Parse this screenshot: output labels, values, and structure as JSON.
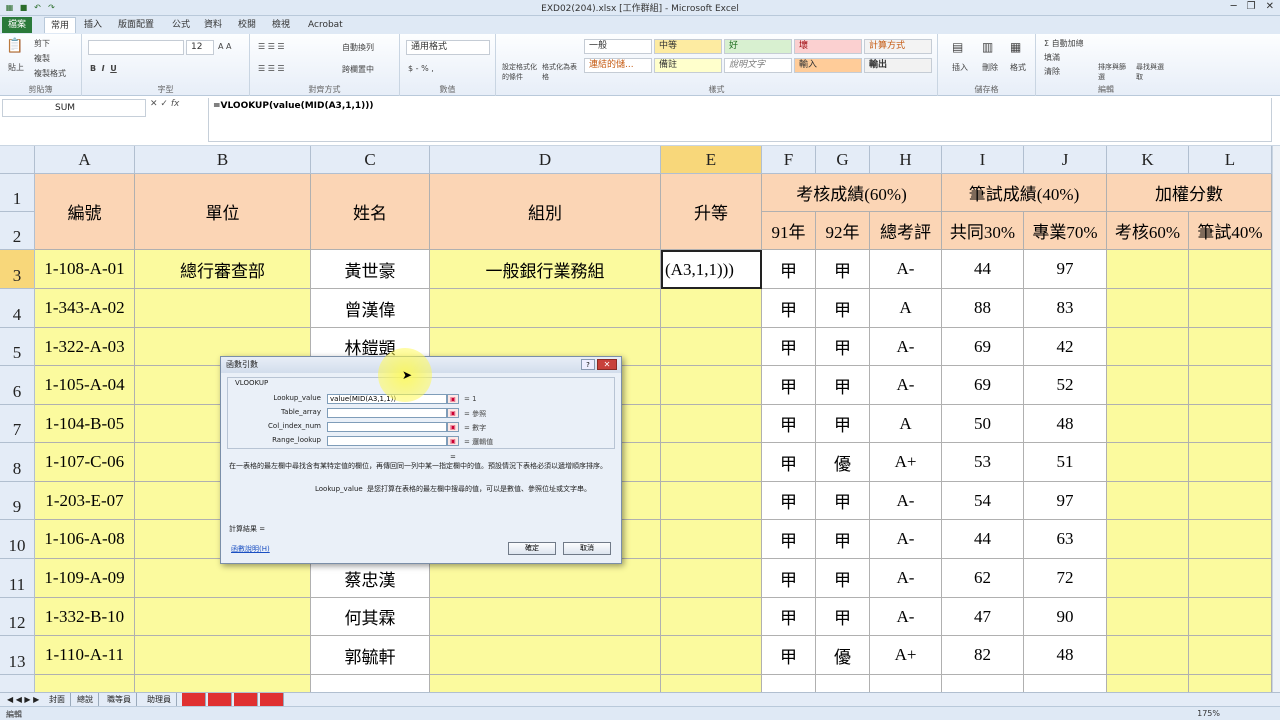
{
  "window": {
    "title": "EXD02(204).xlsx [工作群組] - Microsoft Excel"
  },
  "ribbon_tabs": [
    "檔案",
    "常用",
    "插入",
    "版面配置",
    "公式",
    "資料",
    "校閱",
    "檢視",
    "Acrobat"
  ],
  "ribbon": {
    "clipboard": {
      "label": "剪貼簿",
      "paste": "貼上",
      "cut": "剪下",
      "copy": "複製",
      "format_painter": "複製格式"
    },
    "font": {
      "label": "字型",
      "size": "12"
    },
    "alignment": {
      "label": "對齊方式",
      "wrap": "自動換列",
      "merge": "跨欄置中"
    },
    "number": {
      "label": "數值",
      "format": "通用格式"
    },
    "styles": {
      "label": "樣式",
      "conditional": "設定格式化的條件",
      "as_table": "格式化為表格",
      "items": [
        "一般",
        "中等",
        "好",
        "壞",
        "計算方式",
        "連結的儲...",
        "備註",
        "說明文字",
        "輸入",
        "輸出"
      ]
    },
    "cells": {
      "label": "儲存格",
      "insert": "插入",
      "delete": "刪除",
      "format": "格式"
    },
    "editing": {
      "label": "編輯",
      "autosum": "自動加總",
      "fill": "填滿",
      "clear": "清除",
      "sort": "排序與篩選",
      "find": "尋找與選取"
    }
  },
  "formula_bar": {
    "name_box": "SUM",
    "formula": "=VLOOKUP(value(MID(A3,1,1)))"
  },
  "columns": [
    "A",
    "B",
    "C",
    "D",
    "E",
    "F",
    "G",
    "H",
    "I",
    "J",
    "K",
    "L"
  ],
  "row_numbers": [
    "1",
    "2",
    "3",
    "4",
    "5",
    "6",
    "7",
    "8",
    "9",
    "10",
    "11",
    "12",
    "13"
  ],
  "headers": {
    "id": "編號",
    "unit": "單位",
    "name": "姓名",
    "group": "組別",
    "promotion": "升等",
    "assessment": "考核成績(60%)",
    "written": "筆試成績(40%)",
    "weighted": "加權分數",
    "y91": "91年",
    "y92": "92年",
    "total": "總考評",
    "common": "共同30%",
    "special": "專業70%",
    "assess60": "考核60%",
    "written40": "筆試40%"
  },
  "rows": [
    {
      "id": "1-108-A-01",
      "unit": "總行審查部",
      "name": "黃世豪",
      "group": "一般銀行業務組",
      "promo": "(A3,1,1)))",
      "f": "甲",
      "g": "甲",
      "h": "A-",
      "i": "44",
      "j": "97"
    },
    {
      "id": "1-343-A-02",
      "unit": "",
      "name": "曾漢偉",
      "group": "",
      "promo": "",
      "f": "甲",
      "g": "甲",
      "h": "A",
      "i": "88",
      "j": "83"
    },
    {
      "id": "1-322-A-03",
      "unit": "",
      "name": "林鎧顗",
      "group": "",
      "promo": "",
      "f": "甲",
      "g": "甲",
      "h": "A-",
      "i": "69",
      "j": "42"
    },
    {
      "id": "1-105-A-04",
      "unit": "",
      "name": "",
      "group": "",
      "promo": "",
      "f": "甲",
      "g": "甲",
      "h": "A-",
      "i": "69",
      "j": "52"
    },
    {
      "id": "1-104-B-05",
      "unit": "",
      "name": "",
      "group": "",
      "promo": "",
      "f": "甲",
      "g": "甲",
      "h": "A",
      "i": "50",
      "j": "48"
    },
    {
      "id": "1-107-C-06",
      "unit": "",
      "name": "",
      "group": "",
      "promo": "",
      "f": "甲",
      "g": "優",
      "h": "A+",
      "i": "53",
      "j": "51"
    },
    {
      "id": "1-203-E-07",
      "unit": "",
      "name": "",
      "group": "",
      "promo": "",
      "f": "甲",
      "g": "甲",
      "h": "A-",
      "i": "54",
      "j": "97"
    },
    {
      "id": "1-106-A-08",
      "unit": "",
      "name": "",
      "group": "",
      "promo": "",
      "f": "甲",
      "g": "甲",
      "h": "A-",
      "i": "44",
      "j": "63"
    },
    {
      "id": "1-109-A-09",
      "unit": "",
      "name": "蔡忠漢",
      "group": "",
      "promo": "",
      "f": "甲",
      "g": "甲",
      "h": "A-",
      "i": "62",
      "j": "72"
    },
    {
      "id": "1-332-B-10",
      "unit": "",
      "name": "何其霖",
      "group": "",
      "promo": "",
      "f": "甲",
      "g": "甲",
      "h": "A-",
      "i": "47",
      "j": "90"
    },
    {
      "id": "1-110-A-11",
      "unit": "",
      "name": "郭毓軒",
      "group": "",
      "promo": "",
      "f": "甲",
      "g": "優",
      "h": "A+",
      "i": "82",
      "j": "48"
    }
  ],
  "dialog": {
    "title": "函數引數",
    "function": "VLOOKUP",
    "args": [
      {
        "label": "Lookup_value",
        "value": "value(MID(A3,1,1))",
        "result": "= 1"
      },
      {
        "label": "Table_array",
        "value": "",
        "result": "= 參照"
      },
      {
        "label": "Col_index_num",
        "value": "",
        "result": "= 數字"
      },
      {
        "label": "Range_lookup",
        "value": "",
        "result": "= 邏輯值"
      }
    ],
    "equals_sign": "=",
    "description": "在一表格的最左欄中尋找含有某特定值的欄位，再傳回同一列中某一指定欄中的值。預設情況下表格必須以遞增順序排序。",
    "arg_name": "Lookup_value",
    "arg_description": "是您打算在表格的最左欄中搜尋的值，可以是數值、參照位址或文字串。",
    "result_label": "計算結果 =",
    "help_link": "函數說明(H)",
    "ok": "確定",
    "cancel": "取消"
  },
  "sheet_tabs": [
    "封面",
    "總說",
    "職等員",
    "助理員"
  ],
  "status": {
    "mode": "編輯",
    "zoom": "175%"
  }
}
